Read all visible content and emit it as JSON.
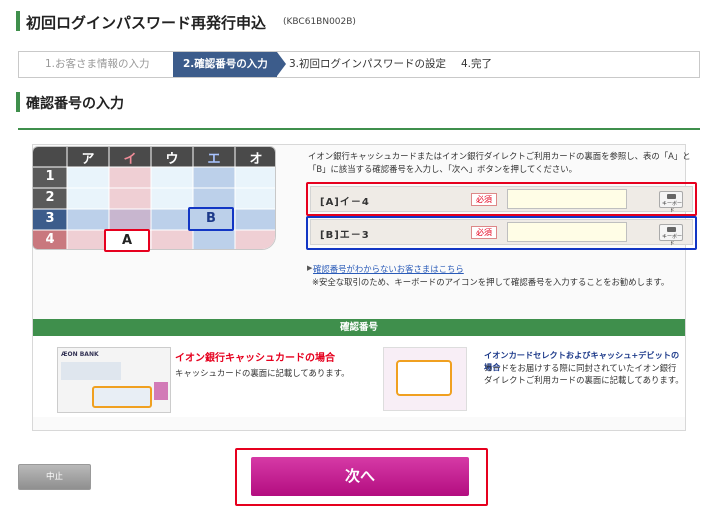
{
  "header": {
    "title": "初回ログインパスワード再発行申込",
    "code": "(KBC61BN002B)"
  },
  "steps": [
    {
      "label": "1.お客さま情報の入力"
    },
    {
      "label": "2.確認番号の入力"
    },
    {
      "label": "3.初回ログインパスワードの設定"
    },
    {
      "label": "4.完了"
    }
  ],
  "section": {
    "title": "確認番号の入力"
  },
  "grid": {
    "cols": [
      "ア",
      "イ",
      "ウ",
      "エ",
      "オ"
    ],
    "rows": [
      "1",
      "2",
      "3",
      "4"
    ],
    "mark_a": "A",
    "mark_b": "B"
  },
  "description": "イオン銀行キャッシュカードまたはイオン銀行ダイレクトご利用カードの裏面を参照し、表の「A」と「B」に該当する確認番号を入力し、「次へ」ボタンを押してください。",
  "inputs": [
    {
      "label": "[A]イ－4",
      "required": "必須",
      "value": "",
      "keyboard": "キーボード"
    },
    {
      "label": "[B]エ－3",
      "required": "必須",
      "value": "",
      "keyboard": "キーボード"
    }
  ],
  "help_link": "確認番号がわからないお客さまはこちら",
  "note": "※安全な取引のため、キーボードのアイコンを押して確認番号を入力することをお勧めします。",
  "confirm": {
    "heading": "確認番号",
    "card1_brand": "ÆON BANK",
    "card1_title": "イオン銀行キャッシュカードの場合",
    "card1_text": "キャッシュカードの裏面に記載してあります。",
    "card2_title": "イオンカードセレクトおよびキャッシュ+デビットの場合",
    "card2_text": "カードをお届けする際に同封されていたイオン銀行ダイレクトご利用カードの裏面に記載してあります。"
  },
  "buttons": {
    "cancel": "中止",
    "next": "次へ"
  },
  "colors": {
    "accent_green": "#3f8f4c",
    "step_active": "#3c5c8b",
    "next_button": "#c21f93",
    "highlight_red": "#e6001e",
    "highlight_blue": "#1236c4"
  }
}
